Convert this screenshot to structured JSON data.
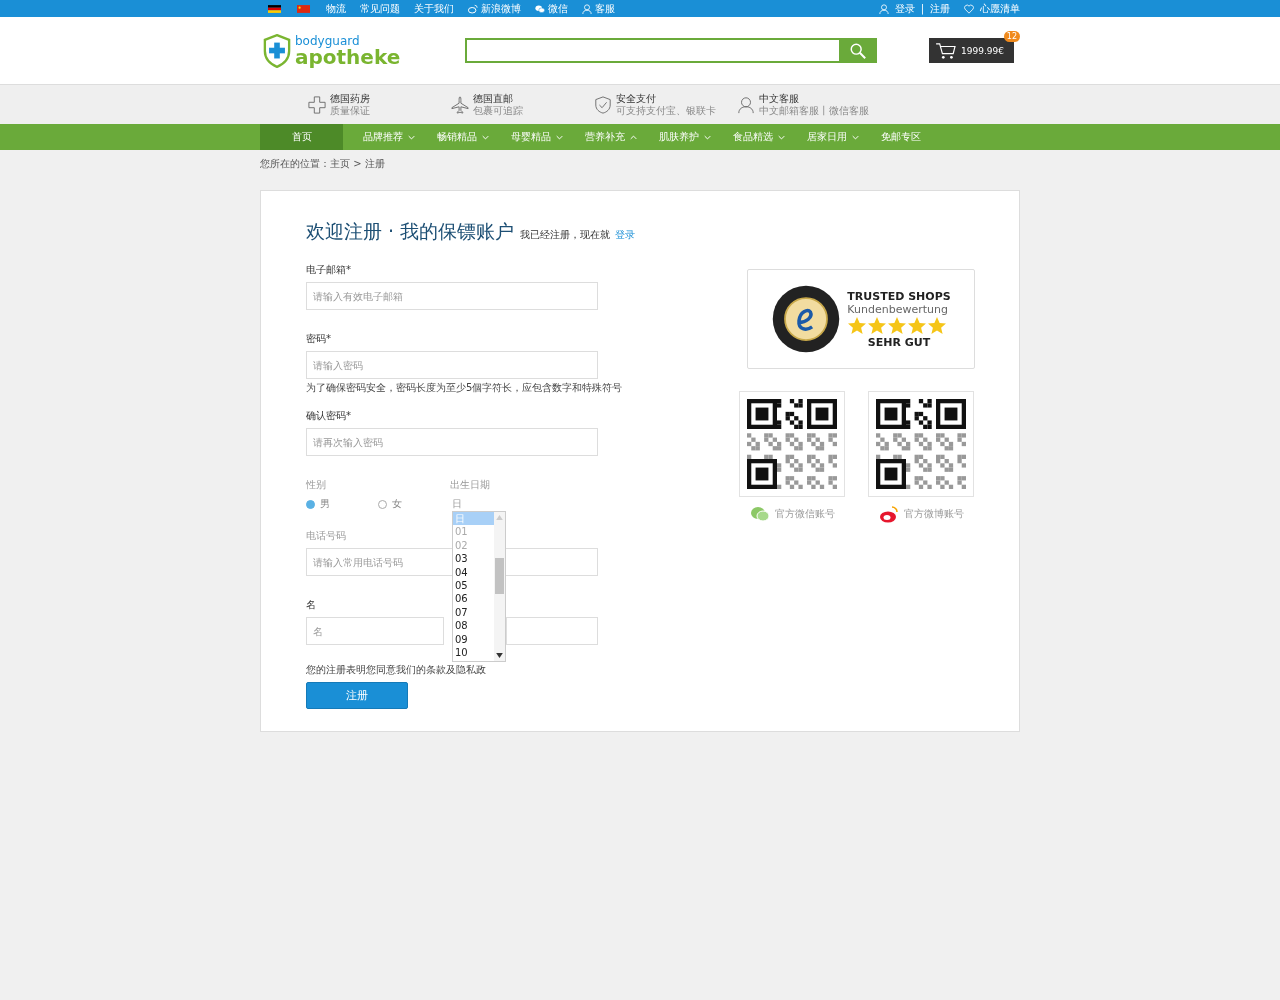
{
  "top_bar": {
    "flags": [
      {
        "kind": "de"
      },
      {
        "kind": "cn"
      }
    ],
    "links": [
      {
        "label": "物流",
        "kind": "plain"
      },
      {
        "label": "常见问题",
        "kind": "plain"
      },
      {
        "label": "关于我们",
        "kind": "plain"
      },
      {
        "label": "新浪微博",
        "kind": "weibo"
      },
      {
        "label": "微信",
        "kind": "wechat"
      },
      {
        "label": "客服",
        "kind": "person"
      }
    ],
    "login": "登录",
    "separator": "|",
    "register": "注册",
    "wishlist": "心愿清单"
  },
  "header": {
    "logo_top": "bodyguard",
    "logo_bottom": "apotheke",
    "cart": {
      "total": "1999.99€",
      "count": "12"
    }
  },
  "features": [
    {
      "kind": "pharmacy",
      "title": "德国药房",
      "subtitle": "质量保证"
    },
    {
      "kind": "shipping",
      "title": "德国直邮",
      "subtitle": "包裹可追踪"
    },
    {
      "kind": "payment",
      "title": "安全支付",
      "subtitle": "可支持支付宝、银联卡"
    },
    {
      "kind": "service",
      "title": "中文客服",
      "subtitle": "中文邮箱客服丨微信客服"
    }
  ],
  "nav": [
    {
      "label": "首页",
      "selected": true,
      "kind": "none"
    },
    {
      "label": "品牌推荐",
      "selected": false,
      "kind": "down"
    },
    {
      "label": "畅销精品",
      "selected": false,
      "kind": "down"
    },
    {
      "label": "母婴精品",
      "selected": false,
      "kind": "down"
    },
    {
      "label": "营养补充",
      "selected": false,
      "kind": "up"
    },
    {
      "label": "肌肤养护",
      "selected": false,
      "kind": "down"
    },
    {
      "label": "食品精选",
      "selected": false,
      "kind": "down"
    },
    {
      "label": "居家日用",
      "selected": false,
      "kind": "down"
    },
    {
      "label": "免邮专区",
      "selected": false,
      "kind": "none"
    }
  ],
  "breadcrumb": "您所在的位置：主页 > 注册",
  "form": {
    "title": "欢迎注册 · 我的保镖账户",
    "login_prompt": "我已经注册，现在就",
    "login_link": "登录",
    "email": {
      "label": "电子邮箱*",
      "placeholder": "请输入有效电子邮箱"
    },
    "password": {
      "label": "密码*",
      "placeholder": "请输入密码",
      "hint": "为了确保密码安全，密码长度为至少5個字符长，应包含数字和特殊符号"
    },
    "confirm": {
      "label": "确认密码*",
      "placeholder": "请再次输入密码"
    },
    "gender": {
      "label": "性别",
      "options": [
        {
          "label": "男",
          "selected": true
        },
        {
          "label": "女",
          "selected": false
        }
      ]
    },
    "birthday": {
      "label": "出生日期",
      "value": "日",
      "options": [
        {
          "label": "日",
          "selected": true,
          "disabled": false
        },
        {
          "label": "01",
          "selected": false,
          "disabled": true
        },
        {
          "label": "02",
          "selected": false,
          "disabled": true
        },
        {
          "label": "03",
          "selected": false,
          "disabled": false
        },
        {
          "label": "04",
          "selected": false,
          "disabled": false
        },
        {
          "label": "05",
          "selected": false,
          "disabled": false
        },
        {
          "label": "06",
          "selected": false,
          "disabled": false
        },
        {
          "label": "07",
          "selected": false,
          "disabled": false
        },
        {
          "label": "08",
          "selected": false,
          "disabled": false
        },
        {
          "label": "09",
          "selected": false,
          "disabled": false
        },
        {
          "label": "10",
          "selected": false,
          "disabled": false
        }
      ]
    },
    "phone": {
      "label": "电话号码",
      "placeholder": "请输入常用电话号码"
    },
    "name": {
      "label": "名",
      "placeholder": "名"
    },
    "terms": "您的注册表明您同意我们的条款及隐私政",
    "submit": "注册"
  },
  "trust": {
    "title": "TRUSTED SHOPS",
    "subtitle": "Kundenbewertung",
    "stars": 5,
    "verdict": "SEHR GUT"
  },
  "qr_codes": [
    {
      "kind": "wechat",
      "caption": "官方微信账号"
    },
    {
      "kind": "weibo",
      "caption": "官方微博账号"
    }
  ]
}
